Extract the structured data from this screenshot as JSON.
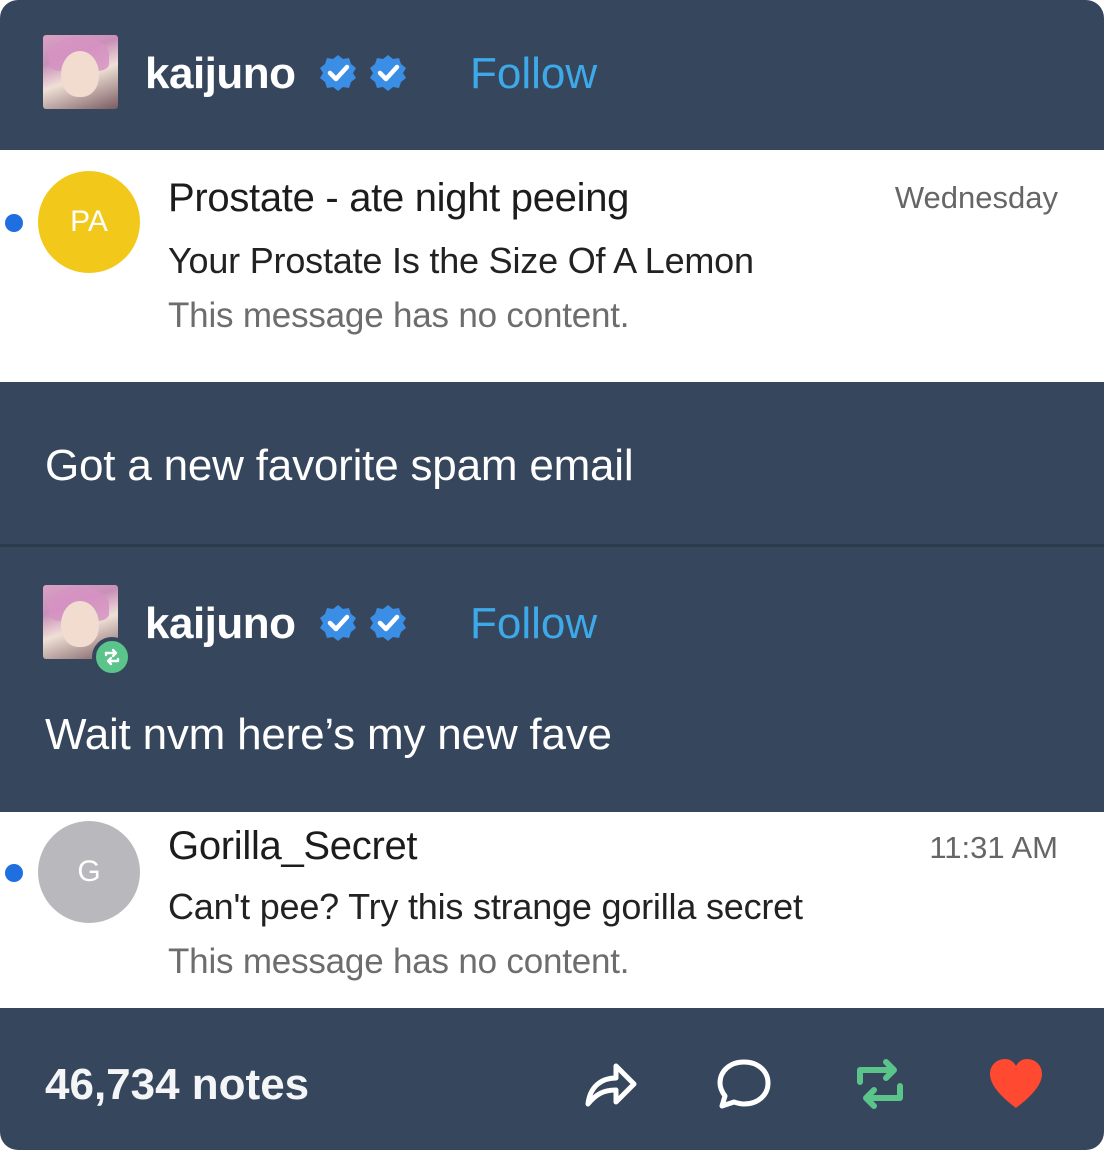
{
  "post": {
    "author": "kaijuno",
    "follow_label": "Follow",
    "verified_badge_icon": "verified-badge-icon",
    "caption": "Got a new favorite spam email"
  },
  "email1": {
    "avatar_initials": "PA",
    "avatar_color": "#f2c91a",
    "sender": "Prostate - ate night peeing",
    "subject": "Your Prostate Is the Size Of A Lemon",
    "preview": "This message has no content.",
    "time": "Wednesday"
  },
  "reblog": {
    "author": "kaijuno",
    "follow_label": "Follow",
    "reblog_icon": "reblog-icon",
    "text": "Wait nvm here’s my new fave"
  },
  "email2": {
    "avatar_initials": "G",
    "avatar_color": "#b9b9bd",
    "sender": "Gorilla_Secret",
    "subject": "Can't pee? Try this strange gorilla secret",
    "preview": "This message has no content.",
    "time": "11:31 AM"
  },
  "footer": {
    "notes": "46,734 notes",
    "actions": [
      "share-icon",
      "reply-icon",
      "reblog-icon",
      "like-heart-icon"
    ]
  },
  "colors": {
    "background": "#36465d",
    "follow": "#3ea9e8",
    "unread_dot": "#1f6fe0",
    "reblog_green": "#5ac48b",
    "heart": "#ff4930"
  }
}
